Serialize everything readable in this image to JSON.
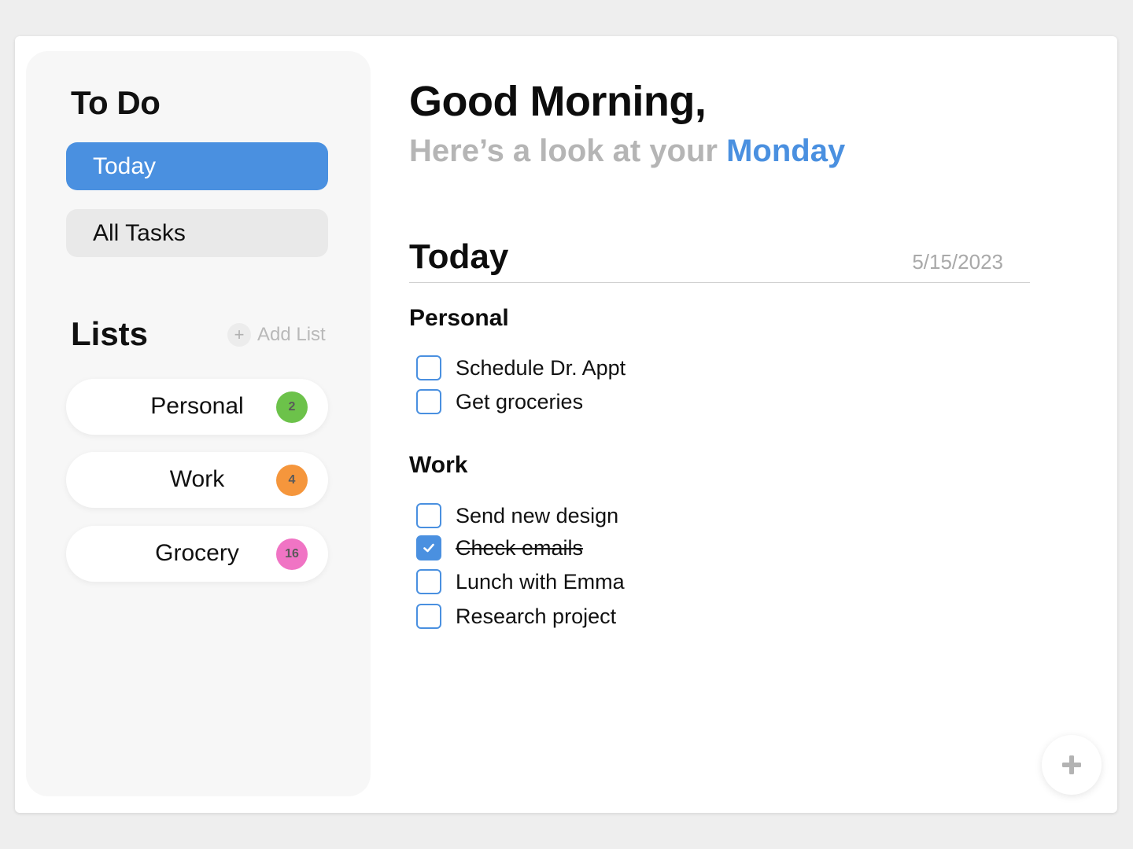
{
  "sidebar": {
    "app_title": "To Do",
    "nav": [
      {
        "label": "Today",
        "active": true
      },
      {
        "label": "All Tasks",
        "active": false
      }
    ],
    "lists_title": "Lists",
    "add_list_label": "Add List",
    "add_list_icon": "+",
    "lists": [
      {
        "label": "Personal",
        "count": "2",
        "color": "#6cc24a"
      },
      {
        "label": "Work",
        "count": "4",
        "color": "#f5963c"
      },
      {
        "label": "Grocery",
        "count": "16",
        "color": "#f074c4"
      }
    ]
  },
  "main": {
    "greeting": "Good Morning,",
    "subgreeting_prefix": "Here’s a look at your ",
    "subgreeting_day": "Monday",
    "section_title": "Today",
    "section_date": "5/15/2023",
    "groups": [
      {
        "title": "Personal",
        "tasks": [
          {
            "label": "Schedule Dr. Appt",
            "done": false
          },
          {
            "label": "Get groceries",
            "done": false
          }
        ]
      },
      {
        "title": "Work",
        "tasks": [
          {
            "label": "Send new design",
            "done": false
          },
          {
            "label": "Check emails",
            "done": true
          },
          {
            "label": "Lunch with Emma",
            "done": false
          },
          {
            "label": "Research project",
            "done": false
          }
        ]
      }
    ]
  },
  "fab_icon": "plus-icon",
  "colors": {
    "accent": "#4a90e0",
    "page_background": "#eeeeee",
    "sidebar_background": "#f7f7f7"
  }
}
